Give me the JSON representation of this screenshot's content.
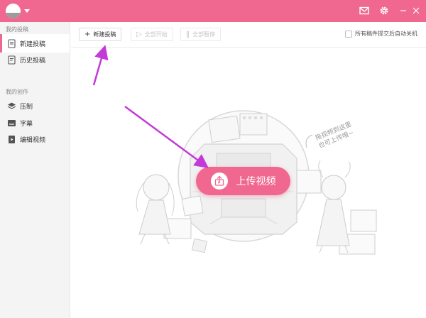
{
  "titlebar": {
    "logo_icon": "bilibili-logo-icon",
    "menu_icon": "caret-down-icon",
    "mail_icon": "mail-icon",
    "settings_icon": "gear-icon",
    "minimize_icon": "minimize-icon",
    "close_icon": "close-icon",
    "color": "#f0688f"
  },
  "sidebar": {
    "section1_title": "我的投稿",
    "section1_items": [
      {
        "label": "新建投稿",
        "icon": "new-upload-icon",
        "active": true
      },
      {
        "label": "历史投稿",
        "icon": "history-icon",
        "active": false
      }
    ],
    "section2_title": "我的创作",
    "section2_items": [
      {
        "label": "压制",
        "icon": "layers-icon",
        "active": false
      },
      {
        "label": "字幕",
        "icon": "subtitle-icon",
        "active": false
      },
      {
        "label": "编辑视频",
        "icon": "edit-video-icon",
        "active": false
      }
    ]
  },
  "toolbar": {
    "new_upload_label": "新建投稿",
    "start_all_label": "全部开始",
    "pause_all_label": "全部暂停",
    "shutdown_label": "所有稿件提交后自动关机"
  },
  "main": {
    "upload_button_label": "上传视频",
    "upload_icon": "upload-icon",
    "hint_text": "拖视频到这里\n也可上传哦~"
  },
  "colors": {
    "accent": "#f0688f",
    "annotation_arrow": "#c43ad8"
  }
}
